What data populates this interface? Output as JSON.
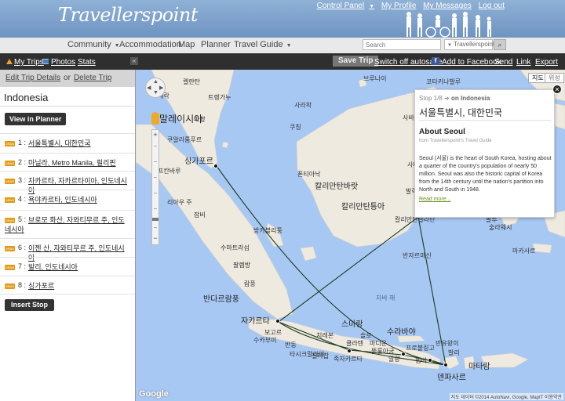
{
  "header": {
    "logo_text": "Travellerspoint",
    "links": [
      "Control Panel",
      "My Profile",
      "My Messages",
      "Log out"
    ]
  },
  "nav": {
    "items": [
      "Community",
      "Accommodation",
      "Map",
      "Planner",
      "Travel Guide"
    ],
    "search_placeholder": "Search",
    "search_scope": "Travellerspoint"
  },
  "sidebar": {
    "top_links": [
      "My Trips",
      "Photos",
      "Stats"
    ],
    "collapse_icon": "«",
    "edit_trip": "Edit Trip Details",
    "or": "or",
    "delete_trip": "Delete Trip",
    "trip_title": "Indonesia",
    "view_in_planner": "View in Planner",
    "drag_label": "DRAG",
    "stops": [
      {
        "num": "1 :",
        "name": "서울특별시, 대한민국"
      },
      {
        "num": "2 :",
        "name": "마닐라, Metro Manila, 필리핀"
      },
      {
        "num": "3 :",
        "name": "자카르타, 자카르타이아, 인도네시아"
      },
      {
        "num": "4 :",
        "name": "욕야카르타, 인도네시아"
      },
      {
        "num": "5 :",
        "name": "브로모 화산, 자와티무르 주, 인도네시아"
      },
      {
        "num": "6 :",
        "name": "이젠 산, 자와티무르 주, 인도네시아"
      },
      {
        "num": "7 :",
        "name": "발리, 인도네시아"
      },
      {
        "num": "8 :",
        "name": "싱가포르"
      }
    ],
    "insert_stop": "Insert Stop"
  },
  "toolbar": {
    "save_trip": "Save Trip",
    "autosave": "Switch off autosave",
    "add_facebook": "Add to Facebook",
    "send": "Send",
    "link": "Link",
    "export": "Export"
  },
  "map": {
    "map_type": "지도",
    "satellite_type": "위성",
    "google": "Google",
    "attribution": "지도 데이터 ©2014 AutoNavi, Google, MapIT   이용약관",
    "labels": {
      "malaysia": "말레이시아",
      "singapore": "싱가포르",
      "jakarta": "자카르타",
      "kuala_lumpur": "쿠알라룸푸르",
      "kelantan": "켈란탄",
      "terengganu": "트렝가누",
      "pahang": "파항",
      "perak": "페락",
      "pekanbaru": "프칸바루",
      "riau": "리아우 주",
      "jambi": "잠비",
      "sumatra_selatan": "수마트라섬",
      "palembang": "팔렘방",
      "bangka": "방카블리퉁",
      "lampung": "람풍",
      "bandar_lampung": "반다르람풍",
      "semarang": "스마랑",
      "surabaya": "수라바야",
      "denpasar": "덴파사르",
      "mataram": "마타람",
      "pontianak": "폰티아낙",
      "kalimantan_barat": "칼리만탄바랏",
      "kalimantan_tengah": "칼리만탄틍아",
      "kalimantan_selatan": "칼리만탄슬라탄",
      "banjarmasin": "반자르마신",
      "samarinda": "사마린다",
      "balikpapan": "발릭파판",
      "palu": "팔루",
      "makassar": "마카사르",
      "sulawesi": "술라웨시",
      "sarawak": "사라왁",
      "kuching": "쿠칭",
      "brunei": "브루나이",
      "sabah": "사바",
      "kota_kinabalu": "코타키나발루",
      "java_sea": "자바 해",
      "bali": "발리",
      "cirebon": "치레본",
      "tasikmalaya": "타시크말라야",
      "bandung": "반둥",
      "bogor": "보고르",
      "sukabumi": "수카부미",
      "cilacap": "칠라찹",
      "yogyakarta": "족자카르타",
      "klaten": "클라텐",
      "solo": "솔로",
      "tulungagung": "뚤룽아궁",
      "probolinggo": "프로볼링고",
      "banyuwangi": "반유왕이",
      "jember": "젬버",
      "malang": "말랑",
      "madiun": "마디운"
    }
  },
  "info": {
    "stop_line": "Stop 1/8",
    "on_trip": "on Indonesia",
    "city": "서울특별시, 대한민국",
    "about": "About Seoul",
    "from": "from Travellerspoint's Travel Guide",
    "desc": "Seoul (서울) is the heart of South Korea, hosting about a quarter of the country's population of nearly 50 million. Seoul was also the historic capital of Korea from the 14th century until the nation's partition into North and South in 1948.",
    "read_more": "Read more..."
  },
  "colors": {
    "header_blue": "#7a9dc9",
    "dark_bar": "#2f2f2f",
    "sea": "#a8c8f4",
    "land": "#eeeae0",
    "drag_orange": "#e19a12",
    "route": "#1c3b1c",
    "link_green": "#6b8c1a"
  },
  "icons": [
    "mytrips-icon",
    "photos-icon",
    "facebook-icon",
    "search-icon",
    "close-icon",
    "pegman-icon",
    "pan-control-icon"
  ]
}
